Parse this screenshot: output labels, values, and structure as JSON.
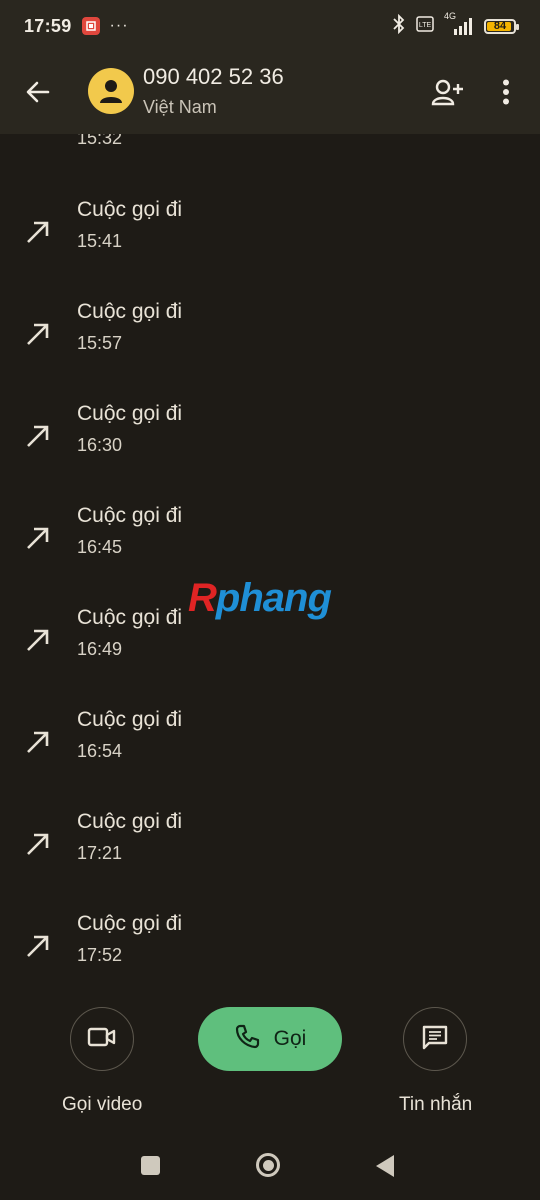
{
  "status_bar": {
    "time": "17:59",
    "dots": "···",
    "battery": "84",
    "network": "4G",
    "icons": [
      "app-notification-icon",
      "bluetooth-icon",
      "volte-icon",
      "signal-icon",
      "battery-icon"
    ]
  },
  "header": {
    "phone_number": "090 402 52 36",
    "location": "Việt Nam",
    "icons": [
      "back-arrow-icon",
      "contact-avatar-icon",
      "add-contact-icon",
      "more-options-icon"
    ]
  },
  "call_log": {
    "partial_time": "15:32",
    "items": [
      {
        "type": "Cuộc gọi đi",
        "time": "15:41"
      },
      {
        "type": "Cuộc gọi đi",
        "time": "15:57"
      },
      {
        "type": "Cuộc gọi đi",
        "time": "16:30"
      },
      {
        "type": "Cuộc gọi đi",
        "time": "16:45"
      },
      {
        "type": "Cuộc gọi đi",
        "time": "16:49"
      },
      {
        "type": "Cuộc gọi đi",
        "time": "16:54"
      },
      {
        "type": "Cuộc gọi đi",
        "time": "17:21"
      },
      {
        "type": "Cuộc gọi đi",
        "time": "17:52"
      }
    ]
  },
  "watermark": {
    "first": "R",
    "rest": "phang"
  },
  "actions": {
    "video_label": "Gọi video",
    "call_label": "Gọi",
    "message_label": "Tin nhắn"
  },
  "colors": {
    "background": "#1e1b16",
    "header_bg": "#2a271f",
    "call_button": "#5fbf7d",
    "avatar": "#f2c94c"
  }
}
